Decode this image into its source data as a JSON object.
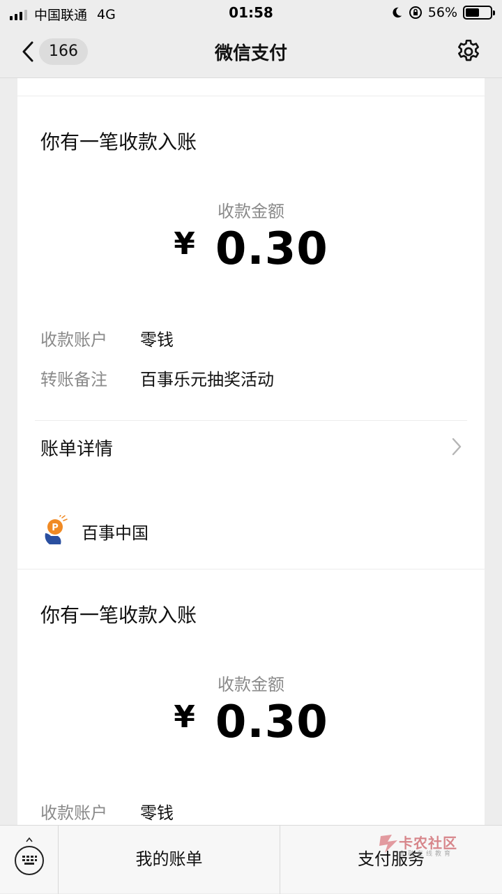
{
  "status": {
    "carrier": "中国联通",
    "network": "4G",
    "time": "01:58",
    "battery_percent": "56%",
    "battery_level": 0.56
  },
  "nav": {
    "badge_count": "166",
    "title": "微信支付"
  },
  "cards": [
    {
      "heading": "你有一笔收款入账",
      "amount_label": "收款金额",
      "currency": "¥",
      "amount": "0.30",
      "account_key": "收款账户",
      "account_value": "零钱",
      "note_key": "转账备注",
      "note_value": "百事乐元抽奖活动",
      "detail_label": "账单详情"
    },
    {
      "merchant": "百事中国",
      "heading": "你有一笔收款入账",
      "amount_label": "收款金额",
      "currency": "¥",
      "amount": "0.30",
      "account_key": "收款账户",
      "account_value": "零钱"
    }
  ],
  "bottom_bar": {
    "tab_bills": "我的账单",
    "tab_services": "支付服务"
  },
  "watermark": {
    "title": "卡农社区",
    "subtitle": "金融在线教育"
  },
  "colors": {
    "background": "#ededed",
    "card": "#ffffff",
    "muted_text": "#8a8a8a",
    "merchant_logo_orange": "#f08a24",
    "merchant_logo_blue": "#2a4fa0"
  }
}
